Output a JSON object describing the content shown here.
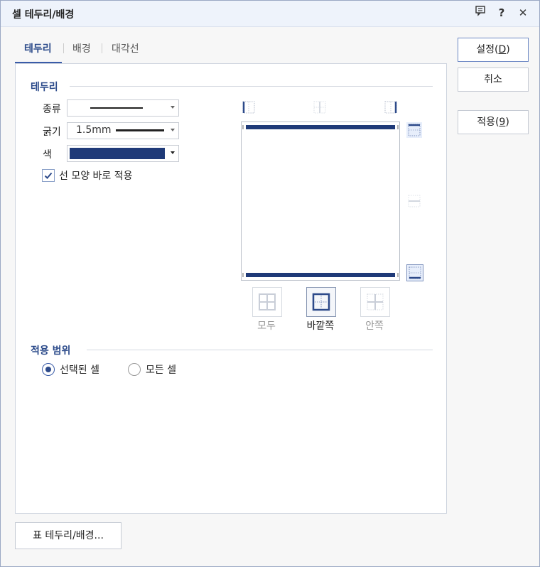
{
  "window": {
    "title": "셀 테두리/배경",
    "icons": [
      "comment-icon",
      "help-icon",
      "close-icon"
    ],
    "help_glyph": "?",
    "close_glyph": "✕"
  },
  "tabs": [
    {
      "label": "테두리",
      "active": true
    },
    {
      "label": "배경",
      "active": false
    },
    {
      "label": "대각선",
      "active": false
    }
  ],
  "border_section": {
    "title": "테두리",
    "type_label": "종류",
    "thickness_label": "굵기",
    "thickness_value": "1.5mm",
    "color_label": "색",
    "color_value": "#1f3a78",
    "apply_checkbox_label": "선 모양 바로 적용",
    "apply_checkbox_checked": true
  },
  "preset_buttons": [
    {
      "label": "모두",
      "enabled": false
    },
    {
      "label": "바깥쪽",
      "enabled": true
    },
    {
      "label": "안쪽",
      "enabled": false
    }
  ],
  "scope_section": {
    "title": "적용 범위",
    "options": [
      {
        "label": "선택된 셀",
        "selected": true
      },
      {
        "label": "모든 셀",
        "selected": false
      }
    ]
  },
  "buttons": {
    "ok": {
      "text": "설정(",
      "key": "D",
      "suffix": ")"
    },
    "cancel": "취소",
    "apply": {
      "text": "적용(",
      "key": "9",
      "suffix": ")"
    },
    "table_border": "표 테두리/배경..."
  },
  "colors": {
    "accent": "#2b4a8a",
    "border_line": "#1f3a78",
    "disabled_text": "#9a9a9a"
  }
}
